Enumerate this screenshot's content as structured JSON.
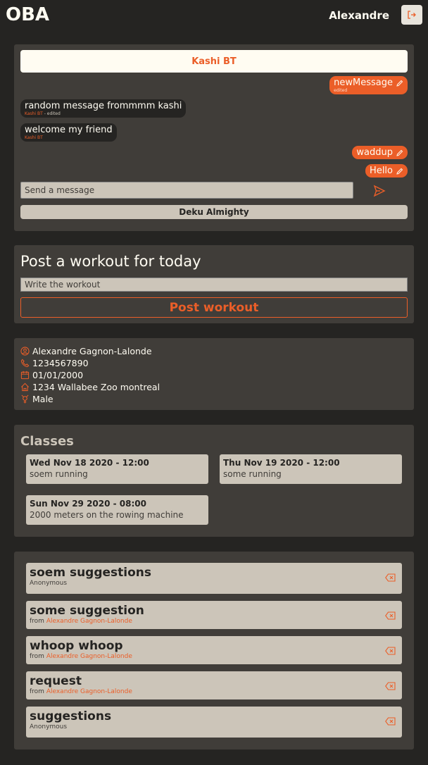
{
  "header": {
    "logo": "OBA",
    "user_name": "Alexandre"
  },
  "chat": {
    "title": "Kashi BT",
    "messages": [
      {
        "from": "me",
        "text": "newMessage",
        "meta": "edited"
      },
      {
        "from": "them",
        "text": "random message frommmm kashi",
        "author": "Kashi BT",
        "meta": " - edited"
      },
      {
        "from": "them",
        "text": "welcome my friend",
        "author": "Kashi BT"
      },
      {
        "from": "me",
        "text": "waddup"
      },
      {
        "from": "me",
        "text": "Hello"
      }
    ],
    "input_placeholder": "Send a message",
    "footer": "Deku Almighty"
  },
  "workout": {
    "title": "Post a workout for today",
    "input_placeholder": "Write the workout",
    "button": "Post workout"
  },
  "profile": {
    "name": "Alexandre Gagnon-Lalonde",
    "phone": "1234567890",
    "birthdate": "01/01/2000",
    "address": "1234 Wallabee Zoo montreal",
    "gender": "Male"
  },
  "classes": {
    "title": "Classes",
    "items": [
      {
        "date": "Wed Nov 18 2020 - 12:00",
        "desc": "soem running"
      },
      {
        "date": "Thu Nov 19 2020 - 12:00",
        "desc": "some running"
      },
      {
        "date": "Sun Nov 29 2020 - 08:00",
        "desc": "2000 meters on the rowing machine"
      }
    ]
  },
  "suggestions": {
    "items": [
      {
        "title": "soem suggestions",
        "from_label": "",
        "author": "Anonymous"
      },
      {
        "title": "some suggestion",
        "from_label": "from ",
        "author": "Alexandre Gagnon-Lalonde"
      },
      {
        "title": "whoop whoop",
        "from_label": "from ",
        "author": "Alexandre Gagnon-Lalonde"
      },
      {
        "title": "request",
        "from_label": "from ",
        "author": "Alexandre Gagnon-Lalonde"
      },
      {
        "title": "suggestions",
        "from_label": "",
        "author": "Anonymous"
      }
    ]
  },
  "colors": {
    "accent": "#eb5e28",
    "background": "#252422",
    "card": "#403d39",
    "light": "#fffcf2",
    "muted": "#ccc5b9"
  }
}
